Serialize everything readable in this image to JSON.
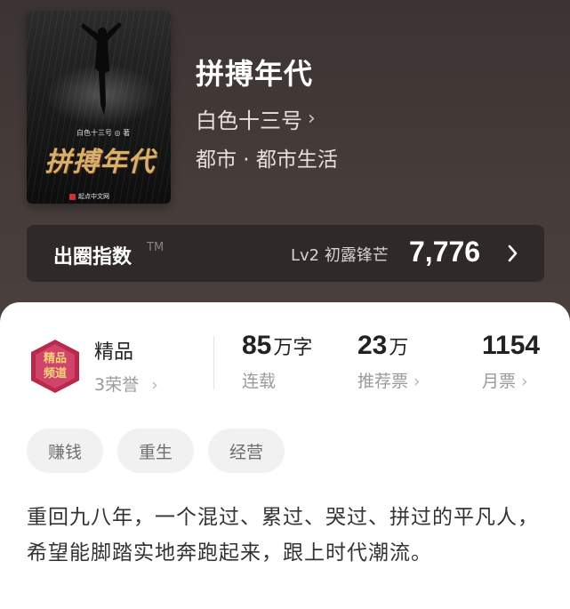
{
  "book": {
    "title": "拼搏年代",
    "author": "白色十三号",
    "genre": "都市 · 都市生活",
    "cover": {
      "title": "拼搏年代",
      "author": "白色十三号 ◎ 著",
      "publisher": "起点中文网"
    }
  },
  "index": {
    "label": "出圈指数",
    "tm": "TM",
    "level": "Lv2 初露锋芒",
    "score": "7,776"
  },
  "honor": {
    "title": "精品",
    "sub": "3荣誉",
    "badge_text": "精品频道"
  },
  "stats": [
    {
      "value": "85",
      "unit": "万字",
      "label": "连载"
    },
    {
      "value": "23",
      "unit": "万",
      "label": "推荐票"
    },
    {
      "value": "1154",
      "unit": "",
      "label": "月票"
    }
  ],
  "tags": [
    "赚钱",
    "重生",
    "经营"
  ],
  "description": "重回九八年，一个混过、累过、哭过、拼过的平凡人，希望能脚踏实地奔跑起来，跟上时代潮流。",
  "colors": {
    "header_bg": "#3b3432",
    "gold": "#d7b070",
    "badge_red": "#b8294a"
  },
  "icons": {
    "chevron": "›"
  }
}
